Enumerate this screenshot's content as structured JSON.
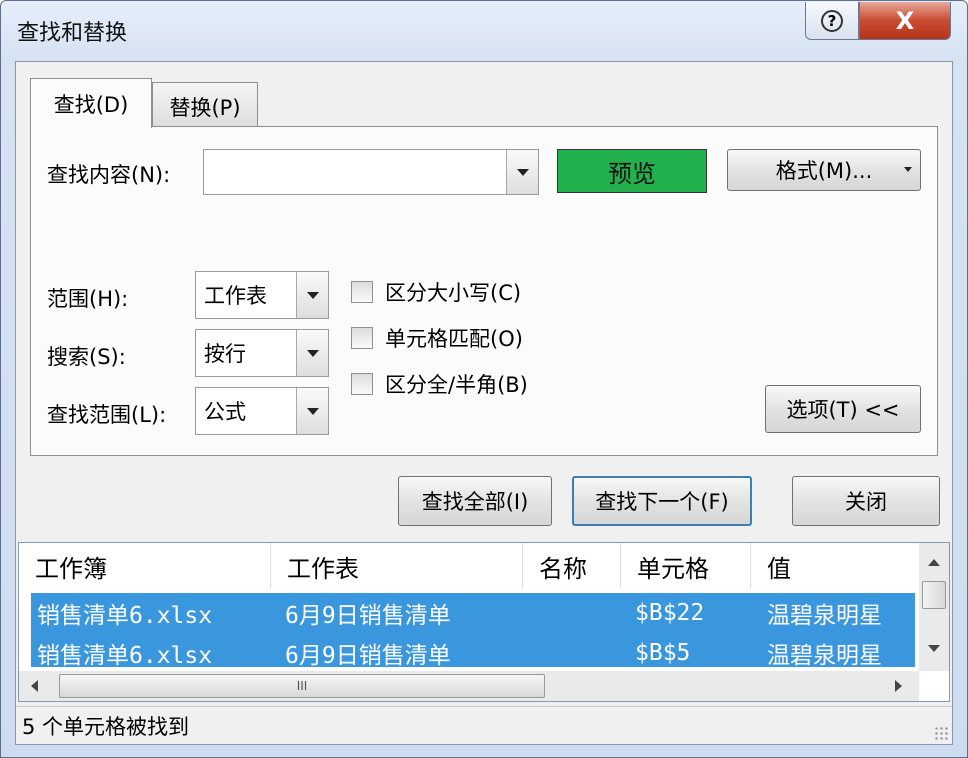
{
  "window": {
    "title": "查找和替换",
    "help_glyph": "?",
    "close_glyph": "X"
  },
  "tabs": {
    "find": "查找(D)",
    "replace": "替换(P)"
  },
  "find": {
    "label": "查找内容(N):",
    "value": ""
  },
  "preview_label": "预览",
  "format_label": "格式(M)...",
  "scope": {
    "label": "范围(H):",
    "value": "工作表"
  },
  "search": {
    "label": "搜索(S):",
    "value": "按行"
  },
  "lookin": {
    "label": "查找范围(L):",
    "value": "公式"
  },
  "checkboxes": {
    "match_case": "区分大小写(C)",
    "match_cell": "单元格匹配(O)",
    "match_width": "区分全/半角(B)"
  },
  "options_label": "选项(T) <<",
  "buttons": {
    "find_all": "查找全部(I)",
    "find_next": "查找下一个(F)",
    "close": "关闭"
  },
  "results": {
    "headers": [
      "工作簿",
      "工作表",
      "名称",
      "单元格",
      "值"
    ],
    "rows": [
      [
        "销售清单6.xlsx",
        "6月9日销售清单",
        "",
        "$B$22",
        "温碧泉明星"
      ],
      [
        "销售清单6.xlsx",
        "6月9日销售清单",
        "",
        "$B$5",
        "温碧泉明星"
      ]
    ],
    "hscroll_grip": "III"
  },
  "status": "5 个单元格被找到",
  "colors": {
    "preview": "#22b14c",
    "selection": "#3a96dd",
    "close": "#c94c32"
  }
}
